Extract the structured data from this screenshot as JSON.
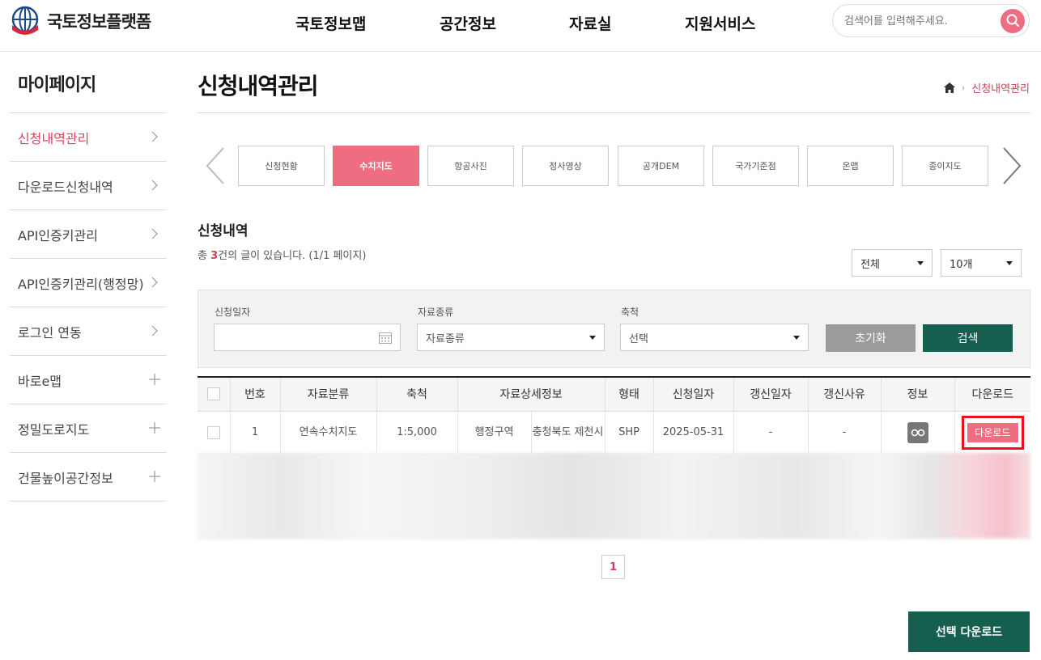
{
  "header": {
    "logo_text": "국토정보플랫폼",
    "nav": [
      "국토정보맵",
      "공간정보",
      "자료실",
      "지원서비스"
    ],
    "search_placeholder": "검색어를 입력해주세요."
  },
  "sidebar": {
    "title": "마이페이지",
    "items": [
      {
        "label": "신청내역관리",
        "icon": "chevron-right-icon",
        "active": true
      },
      {
        "label": "다운로드신청내역",
        "icon": "chevron-right-icon"
      },
      {
        "label": "API인증키관리",
        "icon": "chevron-right-icon"
      },
      {
        "label": "API인증키관리(행정망)",
        "icon": "chevron-right-icon"
      },
      {
        "label": "로그인 연동",
        "icon": "chevron-right-icon"
      },
      {
        "label": "바로e맵",
        "icon": "plus-icon"
      },
      {
        "label": "정밀도로지도",
        "icon": "plus-icon"
      },
      {
        "label": "건물높이공간정보",
        "icon": "plus-icon"
      }
    ]
  },
  "page": {
    "title": "신청내역관리",
    "breadcrumb_current": "신청내역관리"
  },
  "tabs": [
    "신청현황",
    "수치지도",
    "항공사진",
    "정사영상",
    "공개DEM",
    "국가기준점",
    "온맵",
    "종이지도"
  ],
  "active_tab": "수치지도",
  "list": {
    "section_title": "신청내역",
    "count_prefix": "총 ",
    "count_value": "3",
    "count_suffix": "건의 글이 있습니다. (1/1 페이지)",
    "filter_all": "전체",
    "page_size": "10개"
  },
  "filter": {
    "date_label": "신청일자",
    "date_value": "",
    "type_label": "자료종류",
    "type_value": "자료종류",
    "scale_label": "축척",
    "scale_value": "선택",
    "reset_label": "초기화",
    "search_label": "검색"
  },
  "table": {
    "headers": [
      "번호",
      "자료분류",
      "축척",
      "자료상세정보",
      "형태",
      "신청일자",
      "갱신일자",
      "갱신사유",
      "정보",
      "다운로드"
    ],
    "rows": [
      {
        "no": "1",
        "category": "연속수치지도",
        "scale": "1:5,000",
        "detail_1": "행정구역",
        "detail_2": "충청북도 제천시",
        "format": "SHP",
        "request_date": "2025-05-31",
        "update_date": "-",
        "update_reason": "-",
        "download_label": "다운로드"
      }
    ]
  },
  "pagination": {
    "current": "1"
  },
  "bulk_download_label": "선택 다운로드",
  "colors": {
    "accent": "#ee6d80",
    "primary": "#165e4e",
    "highlight": "#e8141c"
  }
}
